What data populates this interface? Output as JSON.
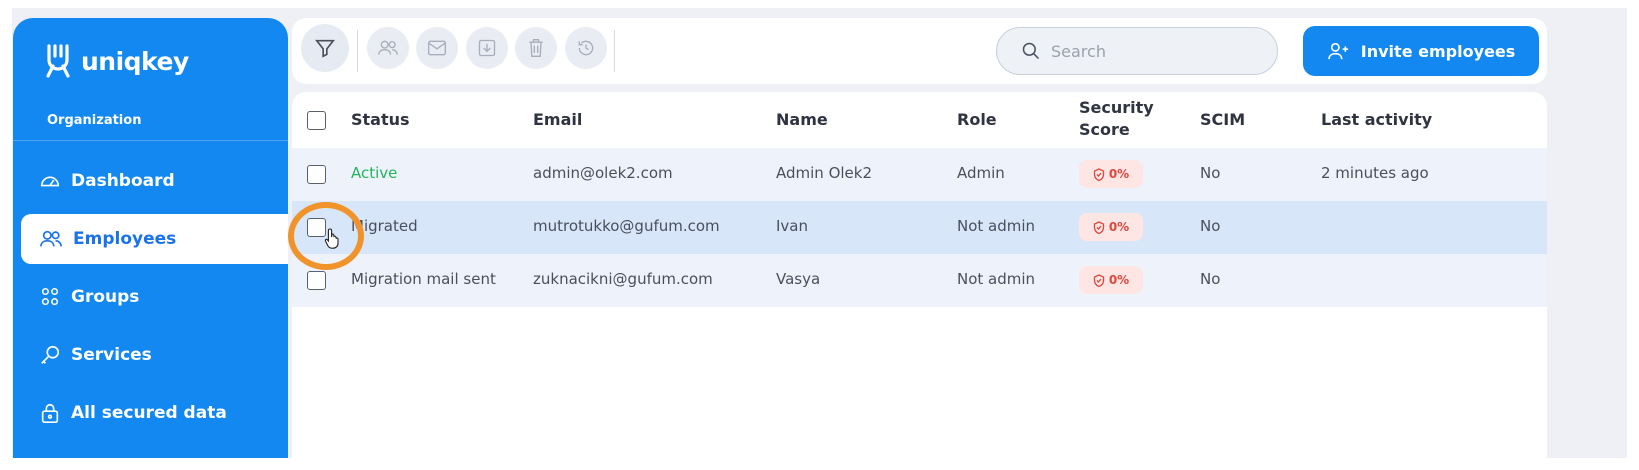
{
  "app": {
    "brand": "uniqkey",
    "org_label": "Organization"
  },
  "sidebar": {
    "items": [
      {
        "label": "Dashboard",
        "icon": "gauge-icon"
      },
      {
        "label": "Employees",
        "icon": "users-icon",
        "active": true
      },
      {
        "label": "Groups",
        "icon": "groups-icon"
      },
      {
        "label": "Services",
        "icon": "key-icon"
      },
      {
        "label": "All secured data",
        "icon": "lock-icon"
      }
    ]
  },
  "toolbar": {
    "icons": [
      "filter-icon",
      "users-icon",
      "mail-icon",
      "download-icon",
      "trash-icon",
      "history-icon"
    ],
    "search_placeholder": "Search",
    "invite_label": "Invite employees"
  },
  "table": {
    "columns": [
      "Status",
      "Email",
      "Name",
      "Role",
      "Security Score",
      "SCIM",
      "Last activity"
    ],
    "rows": [
      {
        "status": "Active",
        "email": "admin@olek2.com",
        "name": "Admin Olek2",
        "role": "Admin",
        "score": "0%",
        "scim": "No",
        "last_activity": "2 minutes ago"
      },
      {
        "status": "Migrated",
        "email": "mutrotukko@gufum.com",
        "name": "Ivan",
        "role": "Not admin",
        "score": "0%",
        "scim": "No",
        "last_activity": ""
      },
      {
        "status": "Migration mail sent",
        "email": "zuknacikni@gufum.com",
        "name": "Vasya",
        "role": "Not admin",
        "score": "0%",
        "scim": "No",
        "last_activity": ""
      }
    ]
  },
  "colors": {
    "brand_blue": "#1288f0",
    "active_green": "#22b55a",
    "score_red": "#e0473d",
    "highlight_orange": "#f0932b"
  }
}
